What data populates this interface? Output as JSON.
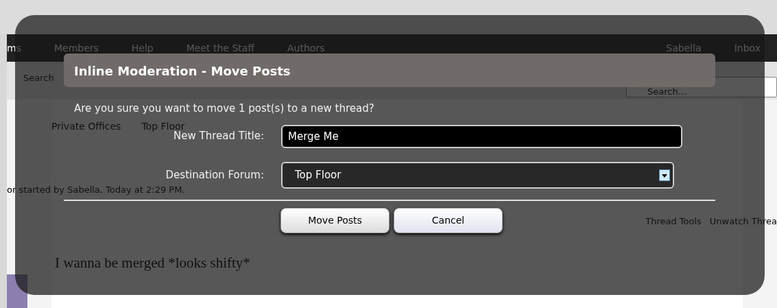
{
  "background_page": {
    "nav_items": [
      {
        "label": "ms"
      },
      {
        "label": "Members"
      },
      {
        "label": "Help"
      },
      {
        "label": "Meet the Staff"
      },
      {
        "label": "Authors"
      }
    ],
    "user_menu": "Sabella",
    "inbox": "Inbox",
    "search_label": "Search",
    "search_placeholder": "Search...",
    "breadcrumbs": [
      {
        "label": "Private Offices"
      },
      {
        "label": "Top Floor"
      }
    ],
    "thread_meta": "or started by Sabella, Today at 2:29 PM.",
    "thread_tools": "Thread Tools",
    "unwatch_link": "Unwatch Threa",
    "post_text": "I wanna be merged *looks shifty*"
  },
  "dialog": {
    "title": "Inline Moderation - Move Posts",
    "question": "Are you sure you want to move 1 post(s) to a new thread?",
    "fields": [
      {
        "kind": "text",
        "label": "New Thread Title:",
        "value": "Merge Me"
      },
      {
        "kind": "select",
        "label": "Destination Forum:",
        "value": "Top Floor"
      }
    ],
    "buttons": [
      {
        "label": "Move Posts"
      },
      {
        "label": "Cancel"
      }
    ]
  }
}
